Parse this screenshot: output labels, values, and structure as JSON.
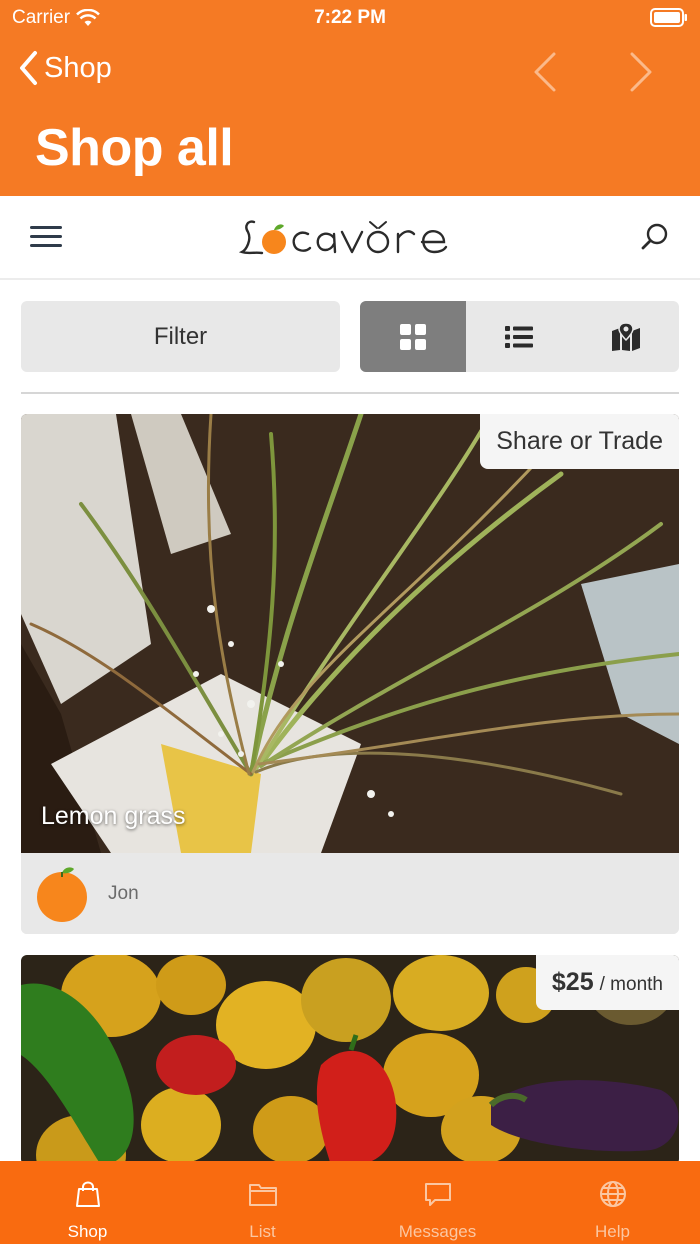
{
  "status_bar": {
    "carrier": "Carrier",
    "time": "7:22 PM"
  },
  "nav": {
    "back_label": "Shop",
    "title": "Shop all"
  },
  "site": {
    "logo_text": "Locavore"
  },
  "toolbar": {
    "filter_label": "Filter",
    "view_modes": [
      {
        "icon": "grid-icon",
        "active": true
      },
      {
        "icon": "list-icon",
        "active": false
      },
      {
        "icon": "map-icon",
        "active": false
      }
    ]
  },
  "listings": [
    {
      "title": "Lemon grass",
      "price_label": "Share or Trade",
      "seller": "Jon"
    },
    {
      "title": "",
      "price": "$25",
      "price_unit": "/ month"
    }
  ],
  "tabbar": {
    "tabs": [
      {
        "label": "Shop",
        "icon": "bag-icon",
        "active": true
      },
      {
        "label": "List",
        "icon": "folder-icon",
        "active": false
      },
      {
        "label": "Messages",
        "icon": "chat-icon",
        "active": false
      },
      {
        "label": "Help",
        "icon": "globe-icon",
        "active": false
      }
    ]
  },
  "colors": {
    "brand": "#f57a24",
    "tabbar": "#f96b10",
    "active_view": "#7e7e7e"
  }
}
